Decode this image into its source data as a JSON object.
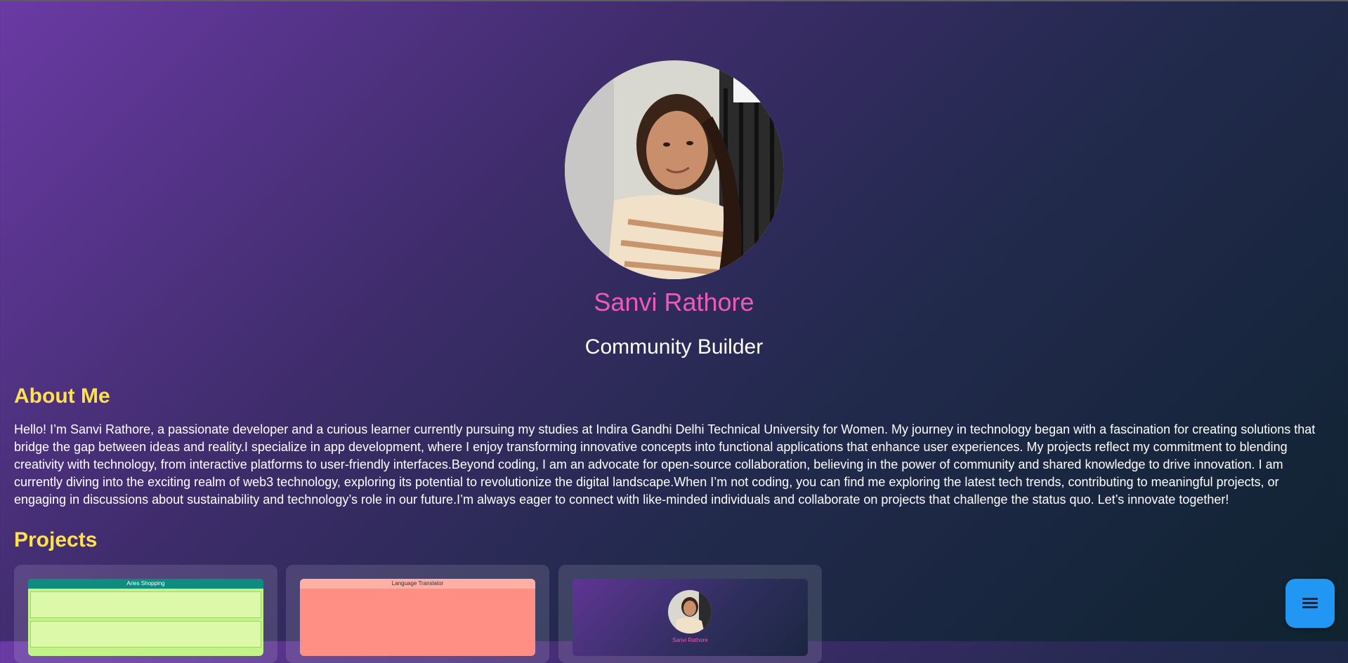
{
  "profile": {
    "name": "Sanvi Rathore",
    "role": "Community Builder"
  },
  "about": {
    "title": "About Me",
    "text": "Hello! I’m Sanvi Rathore, a passionate developer and a curious learner currently pursuing my studies at Indira Gandhi Delhi Technical University for Women. My journey in technology began with a fascination for creating solutions that bridge the gap between ideas and reality.I specialize in app development, where I enjoy transforming innovative concepts into functional applications that enhance user experiences. My projects reflect my commitment to blending creativity with technology, from interactive platforms to user-friendly interfaces.Beyond coding, I am an advocate for open-source collaboration, believing in the power of community and shared knowledge to drive innovation. I am currently diving into the exciting realm of web3 technology, exploring its potential to revolutionize the digital landscape.When I’m not coding, you can find me exploring the latest tech trends, contributing to meaningful projects, or engaging in discussions about sustainability and technology’s role in our future.I’m always eager to connect with like-minded individuals and collaborate on projects that challenge the status quo. Let’s innovate together!"
  },
  "projects": {
    "title": "Projects",
    "cards": [
      {
        "thumb_title": "Aries Shopping"
      },
      {
        "thumb_title": "Language Translator"
      },
      {
        "thumb_title": "Sanvi Rathore"
      }
    ]
  },
  "fab": {
    "icon": "menu-icon"
  },
  "colors": {
    "accent_name": "#ec5bb9",
    "heading": "#ffe14d",
    "fab": "#2196f3"
  }
}
